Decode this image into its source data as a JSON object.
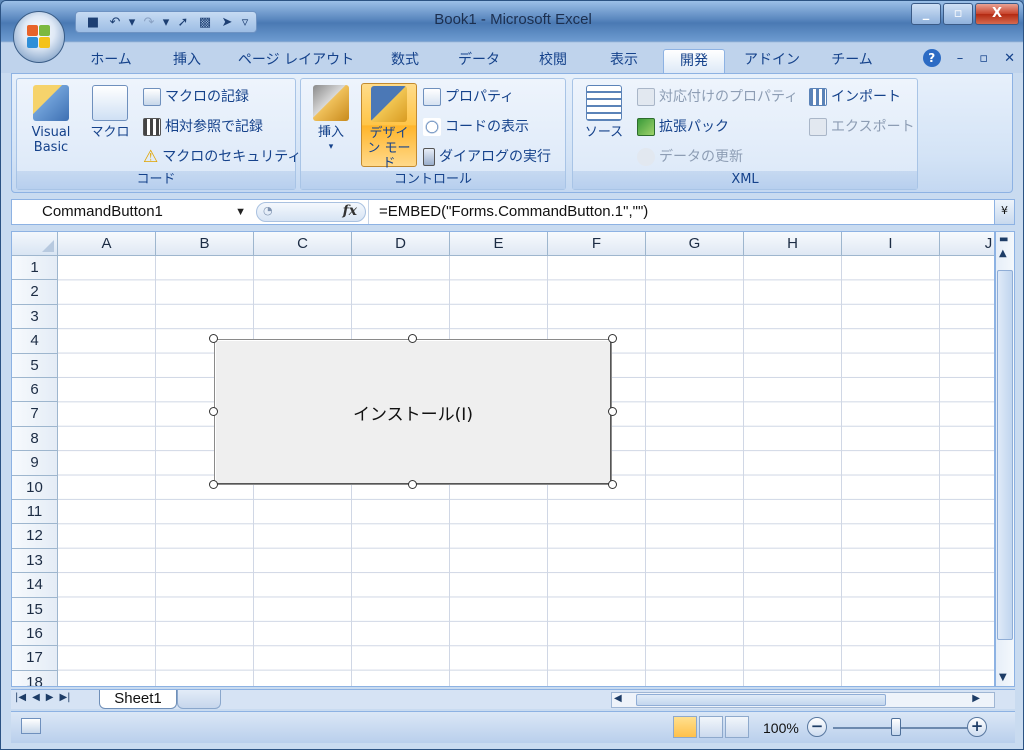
{
  "window": {
    "title": "Book1 - Microsoft Excel",
    "controls": {
      "minimize": "_",
      "restore": "▫",
      "close": "X"
    }
  },
  "quick_access": [
    {
      "icon": "save-icon",
      "glyph": "■"
    },
    {
      "icon": "undo-icon",
      "glyph": "↶"
    },
    {
      "icon": "undo-dropdown-icon",
      "glyph": "▾"
    },
    {
      "icon": "redo-icon",
      "glyph": "↷"
    },
    {
      "icon": "redo-dropdown-icon",
      "glyph": "▾"
    },
    {
      "icon": "select-objects-icon",
      "glyph": "➚"
    },
    {
      "icon": "control-icon",
      "glyph": "▩"
    },
    {
      "icon": "pointer-icon",
      "glyph": "➤"
    },
    {
      "icon": "customize-icon",
      "glyph": "▿"
    }
  ],
  "tabs": [
    "ホーム",
    "挿入",
    "ページ レイアウト",
    "数式",
    "データ",
    "校閲",
    "表示",
    "開発",
    "アドイン",
    "チーム"
  ],
  "active_tab": "開発",
  "ribbon": {
    "code": {
      "label": "コード",
      "visual_basic": "Visual Basic",
      "macro": "マクロ",
      "record_macro": "マクロの記録",
      "relative_ref": "相対参照で記録",
      "macro_security": "マクロのセキュリティ"
    },
    "controls": {
      "label": "コントロール",
      "insert": "挿入",
      "design_mode": "デザイン モード",
      "properties": "プロパティ",
      "view_code": "コードの表示",
      "run_dialog": "ダイアログの実行"
    },
    "xml": {
      "label": "XML",
      "source": "ソース",
      "map_properties": "対応付けのプロパティ",
      "expansion_packs": "拡張パック",
      "refresh_data": "データの更新",
      "import": "インポート",
      "export": "エクスポート"
    }
  },
  "formula_bar": {
    "name_box": "CommandButton1",
    "fx": "fx",
    "formula": "=EMBED(\"Forms.CommandButton.1\",\"\")"
  },
  "columns": [
    "A",
    "B",
    "C",
    "D",
    "E",
    "F",
    "G",
    "H",
    "I",
    "J"
  ],
  "rows": [
    "1",
    "2",
    "3",
    "4",
    "5",
    "6",
    "7",
    "8",
    "9",
    "10",
    "11",
    "12",
    "13",
    "14",
    "15",
    "16",
    "17",
    "18"
  ],
  "command_button": {
    "caption": "インストール(I)"
  },
  "sheet_tabs": {
    "sheets": [
      "Sheet1"
    ]
  },
  "status": {
    "zoom": "100%"
  }
}
